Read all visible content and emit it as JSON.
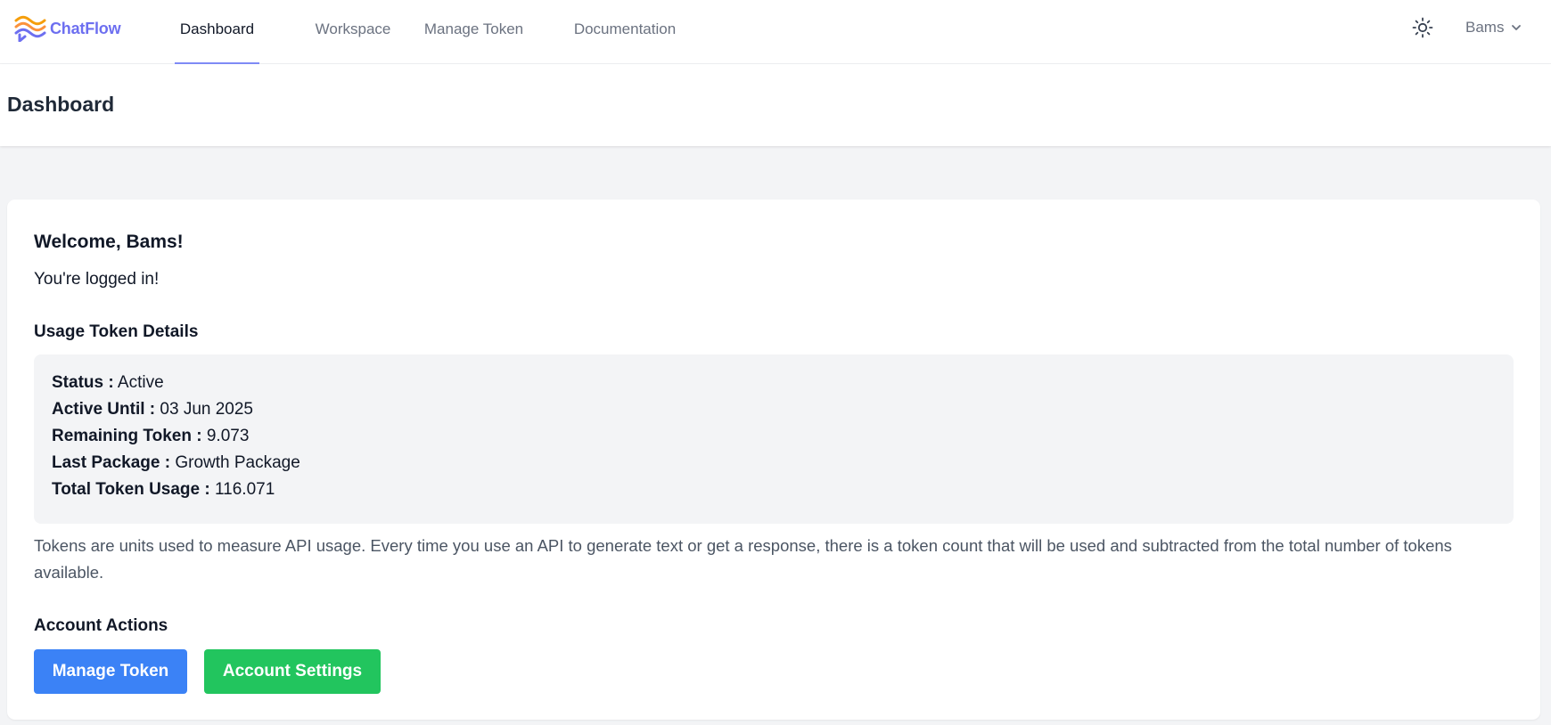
{
  "brand": {
    "name": "ChatFlow",
    "logo_icon": "chatflow-logo-icon"
  },
  "nav": {
    "links": [
      {
        "label": "Dashboard",
        "active": true
      },
      {
        "label": "Workspace",
        "active": false
      },
      {
        "label": "Manage Token",
        "active": false
      },
      {
        "label": "Documentation",
        "active": false
      }
    ],
    "theme_icon": "sun-icon",
    "user": {
      "name": "Bams",
      "icon": "chevron-down-icon"
    }
  },
  "page": {
    "title": "Dashboard"
  },
  "card": {
    "welcome": "Welcome, Bams!",
    "logged_in": "You're logged in!",
    "usage_heading": "Usage Token Details",
    "details": [
      {
        "label": "Status :",
        "value": "Active"
      },
      {
        "label": "Active Until :",
        "value": "03 Jun 2025"
      },
      {
        "label": "Remaining Token :",
        "value": "9.073"
      },
      {
        "label": "Last Package :",
        "value": "Growth Package"
      },
      {
        "label": "Total Token Usage :",
        "value": "116.071"
      }
    ],
    "info": "Tokens are units used to measure API usage. Every time you use an API to generate text or get a response, there is a token count that will be used and subtracted from the total number of tokens available.",
    "actions_heading": "Account Actions",
    "buttons": {
      "manage_token": "Manage Token",
      "account_settings": "Account Settings"
    }
  },
  "colors": {
    "brand": "#6d6ff0",
    "nav_active_underline": "#818cf8",
    "manage_button": "#3b82f6",
    "settings_button": "#22c55e",
    "page_background": "#f3f4f6"
  }
}
